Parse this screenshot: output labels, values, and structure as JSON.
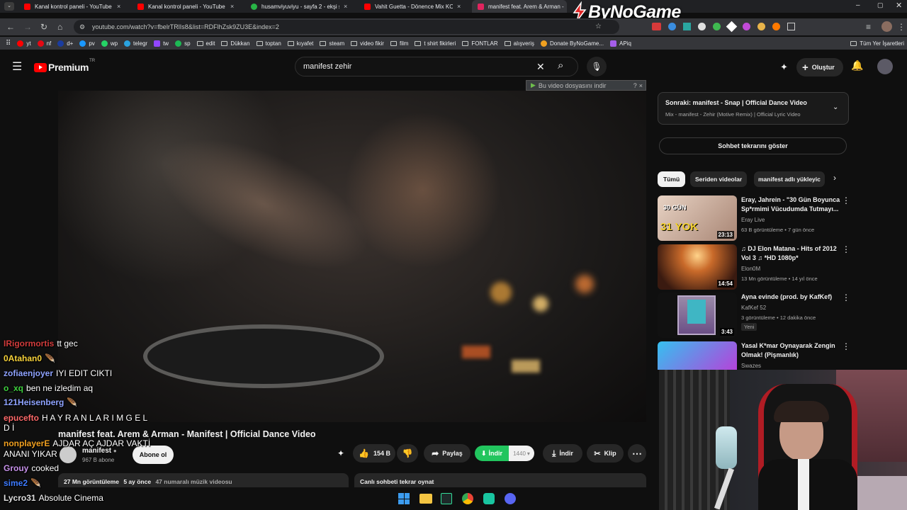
{
  "browser": {
    "tabs": [
      {
        "label": "Kanal kontrol paneli - YouTube",
        "close": "×"
      },
      {
        "label": "Kanal kontrol paneli - YouTube",
        "close": "×"
      },
      {
        "label": "husamviyuviyu - sayfa 2 - ekşi s",
        "close": "×"
      },
      {
        "label": "Vahit Guetta - Dönence Mix KO",
        "close": "×"
      },
      {
        "label": "manifest feat. Arem & Arman -",
        "close": "×"
      }
    ],
    "watermark": "ByNoGame",
    "url": "youtube.com/watch?v=fbelrTRlIs8&list=RDFlhZsk9ZU3E&index=2",
    "bookmarks": [
      "yt",
      "nf",
      "d+",
      "pv",
      "wp",
      "telegr",
      "tw",
      "sp",
      "edit",
      "Dükkan",
      "toptan",
      "kıyafet",
      "steam",
      "video fikir",
      "film",
      "t shirt fikirleri",
      "FONTLAR",
      "alışveriş",
      "Donate ByNoGame...",
      "APiq",
      "Tüm Yer İşaretleri"
    ]
  },
  "yt_header": {
    "logo": "Premium",
    "logo_region": "TR",
    "search_value": "manifest zehir",
    "clear": "✕",
    "create_label": "Oluştur"
  },
  "download_bar": {
    "label": "Bu video dosyasını indir",
    "help": "?",
    "close": "×"
  },
  "video": {
    "title": "manifest feat. Arem & Arman - Manifest | Official Dance Video",
    "channel": "manifest",
    "subscribers": "967 B abone",
    "subscribe_label": "Abone ol",
    "likes": "154 B",
    "share_label": "Paylaş",
    "download_green_label": "İndir",
    "quality": "1440",
    "download_label": "İndir",
    "clip_label": "Klip",
    "more": "⋯",
    "views_line": "27 Mn görüntüleme",
    "ago": "5 ay önce",
    "rank": "47 numaralı müzik videosu",
    "replay_chat": "Canlı sohbeti tekrar oynat"
  },
  "sidebar": {
    "next_title": "Sonraki: manifest - Snap | Official Dance Video",
    "next_sub": "Mix - manifest - Zehir (Motive Remix) | Official Lyric Video",
    "chat_replay": "Sohbet tekrarını göster",
    "chips": [
      "Tümü",
      "Seriden videolar",
      "manifest adlı yükleyic"
    ],
    "recommendations": [
      {
        "title": "Eray, Jahrein - \"30 Gün Boyunca Sp*rmimi Vücudumda Tutmayı...",
        "channel": "Eray Live",
        "meta": "63 B görüntüleme • 7 gün önce",
        "duration": "23:13",
        "thumb_text_1": "30 GÜN",
        "thumb_text_2": "31 YOK",
        "badge": ""
      },
      {
        "title": "♫ DJ Elon Matana - Hits of 2012 Vol 3 ♫ *HD 1080p*",
        "channel": "Elon0M",
        "meta": "13 Mn görüntüleme • 14 yıl önce",
        "duration": "14:54",
        "badge": ""
      },
      {
        "title": "Ayna evinde (prod. by KafKef)",
        "channel": "KafKef 52",
        "meta": "3 görüntüleme • 12 dakika önce",
        "duration": "3:43",
        "badge": "Yeni"
      },
      {
        "title": "Yasal K*mar Oynayarak Zengin Olmak! (Pişmanlık)",
        "channel": "Swazes",
        "meta": "",
        "duration": "",
        "badge": ""
      }
    ]
  },
  "chat": [
    {
      "user": "IRigormortis",
      "msg": "tt gec",
      "color": "#d23c3c"
    },
    {
      "user": "0Atahan0",
      "msg": "",
      "color": "#f7d23a"
    },
    {
      "user": "zofiaenjoyer",
      "msg": "IYI EDIT CIKTI",
      "color": "#8fa3ff"
    },
    {
      "user": "o_xq",
      "msg": "ben ne izledim aq",
      "color": "#3fd13f"
    },
    {
      "user": "121Heisenberg",
      "msg": "",
      "color": "#8fa3ff"
    },
    {
      "user": "epucefto",
      "msg": "H A Y R A N L A R I M G E L",
      "color": "#ff6a6a"
    },
    {
      "user": "",
      "msg": "D İ",
      "color": "#ffffff"
    },
    {
      "user": "nonplayerE",
      "msg": "AJDAR AÇ AJDAR VAKTİ",
      "color": "#f0a020"
    },
    {
      "user": "",
      "msg": "ANANI YIKAR",
      "color": "#ffffff"
    },
    {
      "user": "Grouy",
      "msg": "cooked",
      "color": "#c792ea"
    },
    {
      "user": "sime2",
      "msg": "",
      "color": "#3d7bff"
    },
    {
      "user": "Lycro31",
      "msg": "Absolute Cinema",
      "color": "#e0e0e0"
    }
  ]
}
